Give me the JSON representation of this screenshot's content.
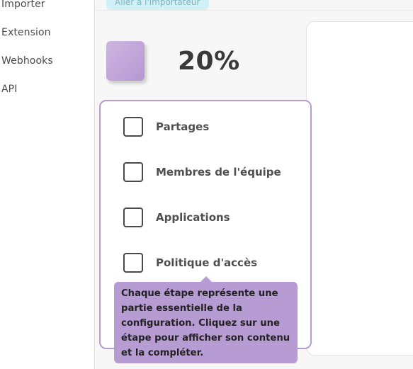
{
  "sidebar": {
    "items": [
      {
        "label": "Importer"
      },
      {
        "label": "Extension"
      },
      {
        "label": "Webhooks"
      },
      {
        "label": "API"
      }
    ]
  },
  "banner": {
    "label": "Aller à l'importateur"
  },
  "progress": {
    "percent_label": "20%",
    "value": 0.2,
    "tile_color": "#b79bd3"
  },
  "steps": [
    {
      "label": "Partages",
      "checked": false
    },
    {
      "label": "Membres de l'équipe",
      "checked": false
    },
    {
      "label": "Applications",
      "checked": false
    },
    {
      "label": "Politique d'accès",
      "checked": false
    }
  ],
  "tooltip": {
    "text": "Chaque étape représente une partie essentielle de la configuration. Cliquez sur une étape pour afficher son contenu et la compléter."
  },
  "colors": {
    "accent": "#b79bd3",
    "banner": "#d2f1f6"
  }
}
